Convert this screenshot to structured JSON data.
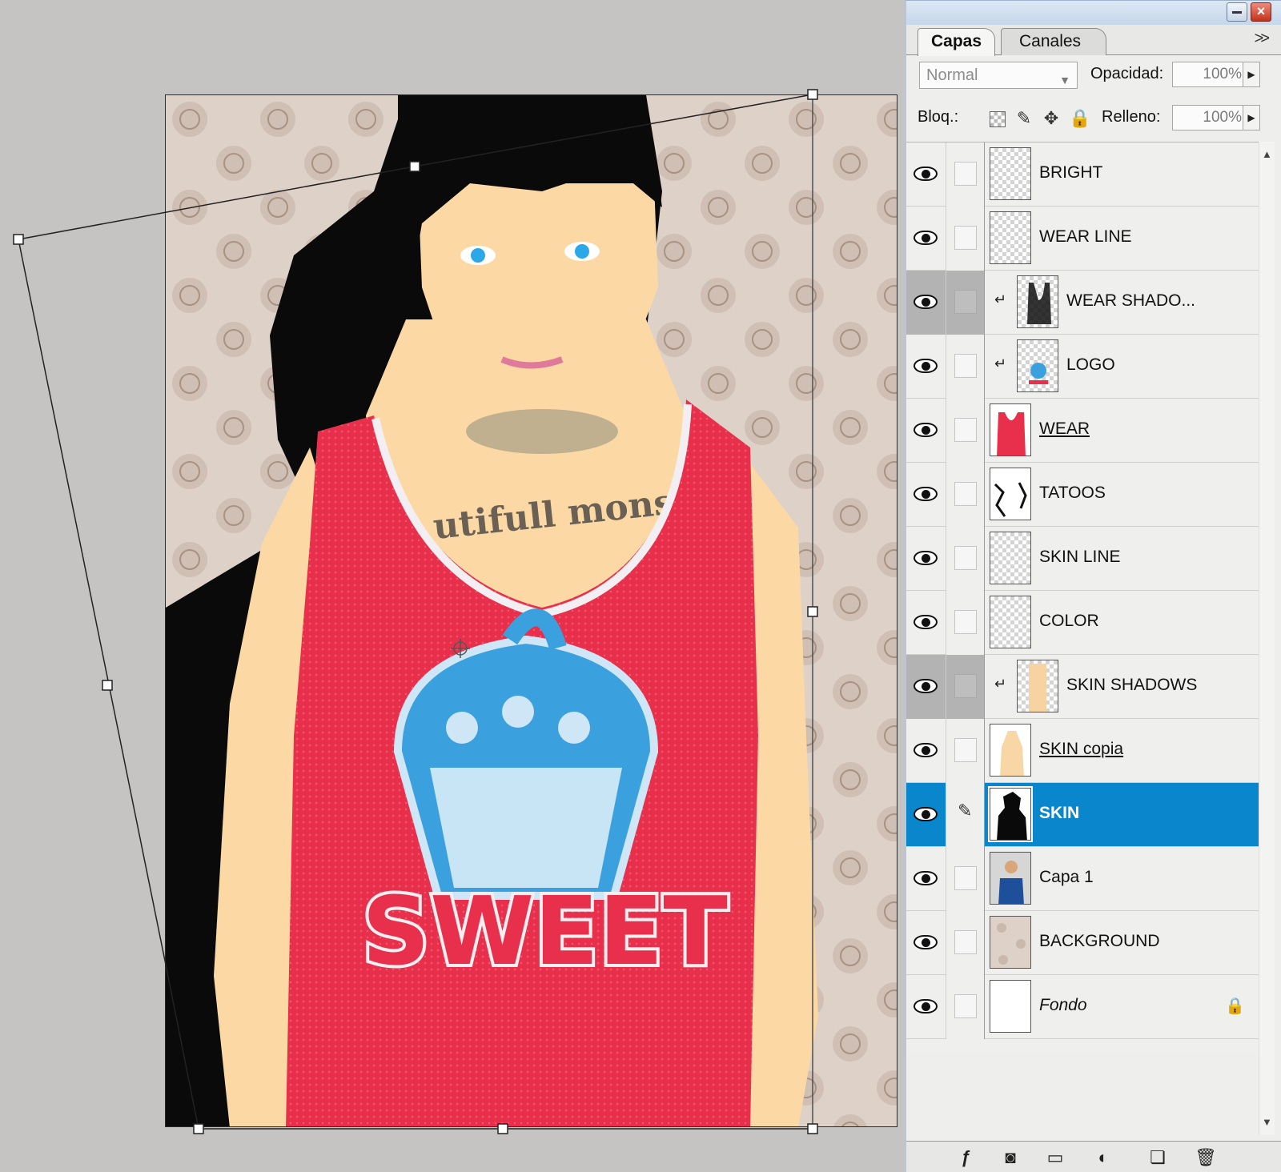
{
  "panel": {
    "tabs": [
      {
        "label": "Capas",
        "active": true
      },
      {
        "label": "Canales",
        "active": false
      }
    ],
    "menu_icon": "double-chevron-right-icon",
    "blend_mode": "Normal",
    "opacity_label": "Opacidad:",
    "opacity_value": "100%",
    "lock_label": "Bloq.:",
    "fill_label": "Relleno:",
    "fill_value": "100%",
    "selection_color": "#0a86cc"
  },
  "layers": [
    {
      "name": "BRIGHT",
      "thumb": "transparent",
      "visible": true
    },
    {
      "name": "WEAR LINE",
      "thumb": "transparent",
      "visible": true
    },
    {
      "name": "WEAR SHADO...",
      "thumb": "tank-outline",
      "visible": true,
      "clipped": true,
      "dimmed": true
    },
    {
      "name": "LOGO",
      "thumb": "logo",
      "visible": true,
      "clipped": true
    },
    {
      "name": "WEAR",
      "thumb": "red-tank",
      "visible": true,
      "underline": true
    },
    {
      "name": "TATOOS",
      "thumb": "tattoo",
      "visible": true
    },
    {
      "name": "SKIN LINE",
      "thumb": "transparent",
      "visible": true
    },
    {
      "name": "COLOR",
      "thumb": "transparent",
      "visible": true
    },
    {
      "name": "SKIN SHADOWS",
      "thumb": "skin-shadow",
      "visible": true,
      "clipped": true,
      "dimmed": true
    },
    {
      "name": "SKIN copia",
      "thumb": "skin-fill",
      "visible": true,
      "underline": true
    },
    {
      "name": "SKIN",
      "thumb": "silhouette",
      "visible": true,
      "selected": true,
      "brush": true
    },
    {
      "name": "Capa 1",
      "thumb": "photo",
      "visible": true
    },
    {
      "name": "BACKGROUND",
      "thumb": "pattern",
      "visible": true
    },
    {
      "name": "Fondo",
      "thumb": "white",
      "visible": true,
      "italic": true,
      "locked": true
    }
  ],
  "artwork": {
    "shirt_text": "SWEET",
    "tattoo_text": "utifull monst",
    "colors": {
      "shirt": "#e8304c",
      "skin": "#fcd9a4",
      "hair": "#0a0a0a",
      "logo": "#3aa0de",
      "wallpaper": "#ddd1c8"
    }
  },
  "footer_icons": [
    "fx-icon",
    "mask-icon",
    "folder-icon",
    "adjustment-icon",
    "new-layer-icon",
    "trash-icon"
  ]
}
